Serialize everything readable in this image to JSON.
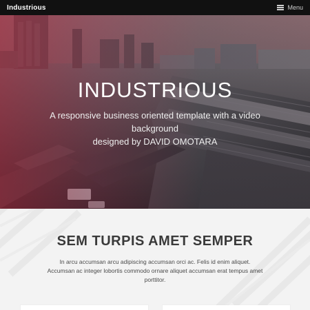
{
  "nav": {
    "brand": "Industrious",
    "menu_label": "Menu",
    "menu_icon": "hamburger-icon"
  },
  "hero": {
    "title": "INDUSTRIOUS",
    "subtitle": "A responsive business oriented template with a video\nbackground\ndesigned by DAVID OMOTARA",
    "overlay_color": "#af263c"
  },
  "section": {
    "title": "SEM TURPIS AMET SEMPER",
    "body": "In arcu accumsan arcu adipiscing accumsan orci ac. Felis id enim aliquet. Accumsan ac integer lobortis commodo ornare aliquet accumsan erat tempus amet porttitor."
  }
}
